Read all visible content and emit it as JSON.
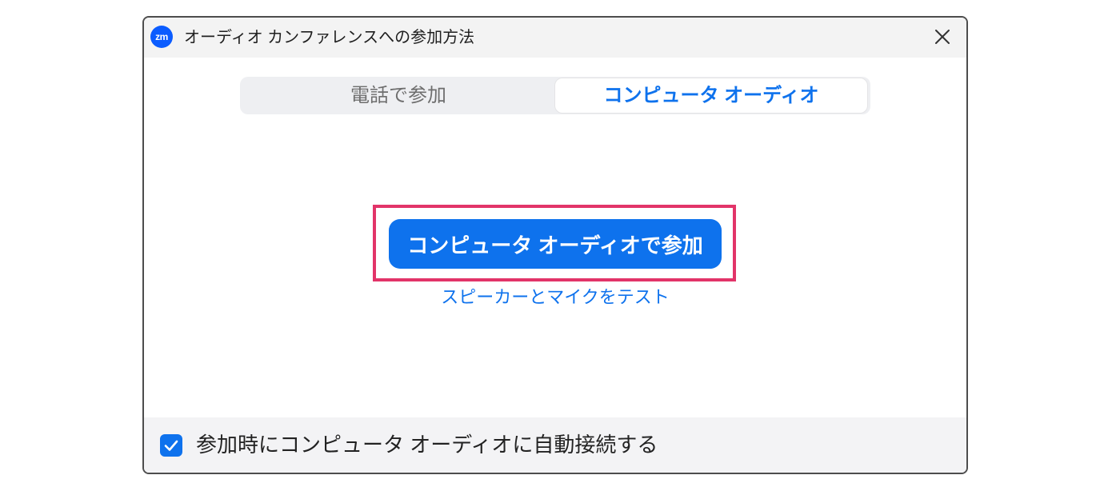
{
  "window": {
    "logo_text": "zm",
    "title": "オーディオ カンファレンスへの参加方法",
    "close_icon": "close-icon"
  },
  "tabs": [
    {
      "label": "電話で参加",
      "active": false
    },
    {
      "label": "コンピュータ オーディオ",
      "active": true
    }
  ],
  "main": {
    "join_button_label": "コンピュータ オーディオで参加",
    "test_link_label": "スピーカーとマイクをテスト"
  },
  "footer": {
    "auto_connect_label": "参加時にコンピュータ オーディオに自動接続する",
    "auto_connect_checked": true,
    "checkbox_icon": "checkmark-icon"
  },
  "colors": {
    "accent": "#0e72ed",
    "highlight": "#e23469"
  }
}
